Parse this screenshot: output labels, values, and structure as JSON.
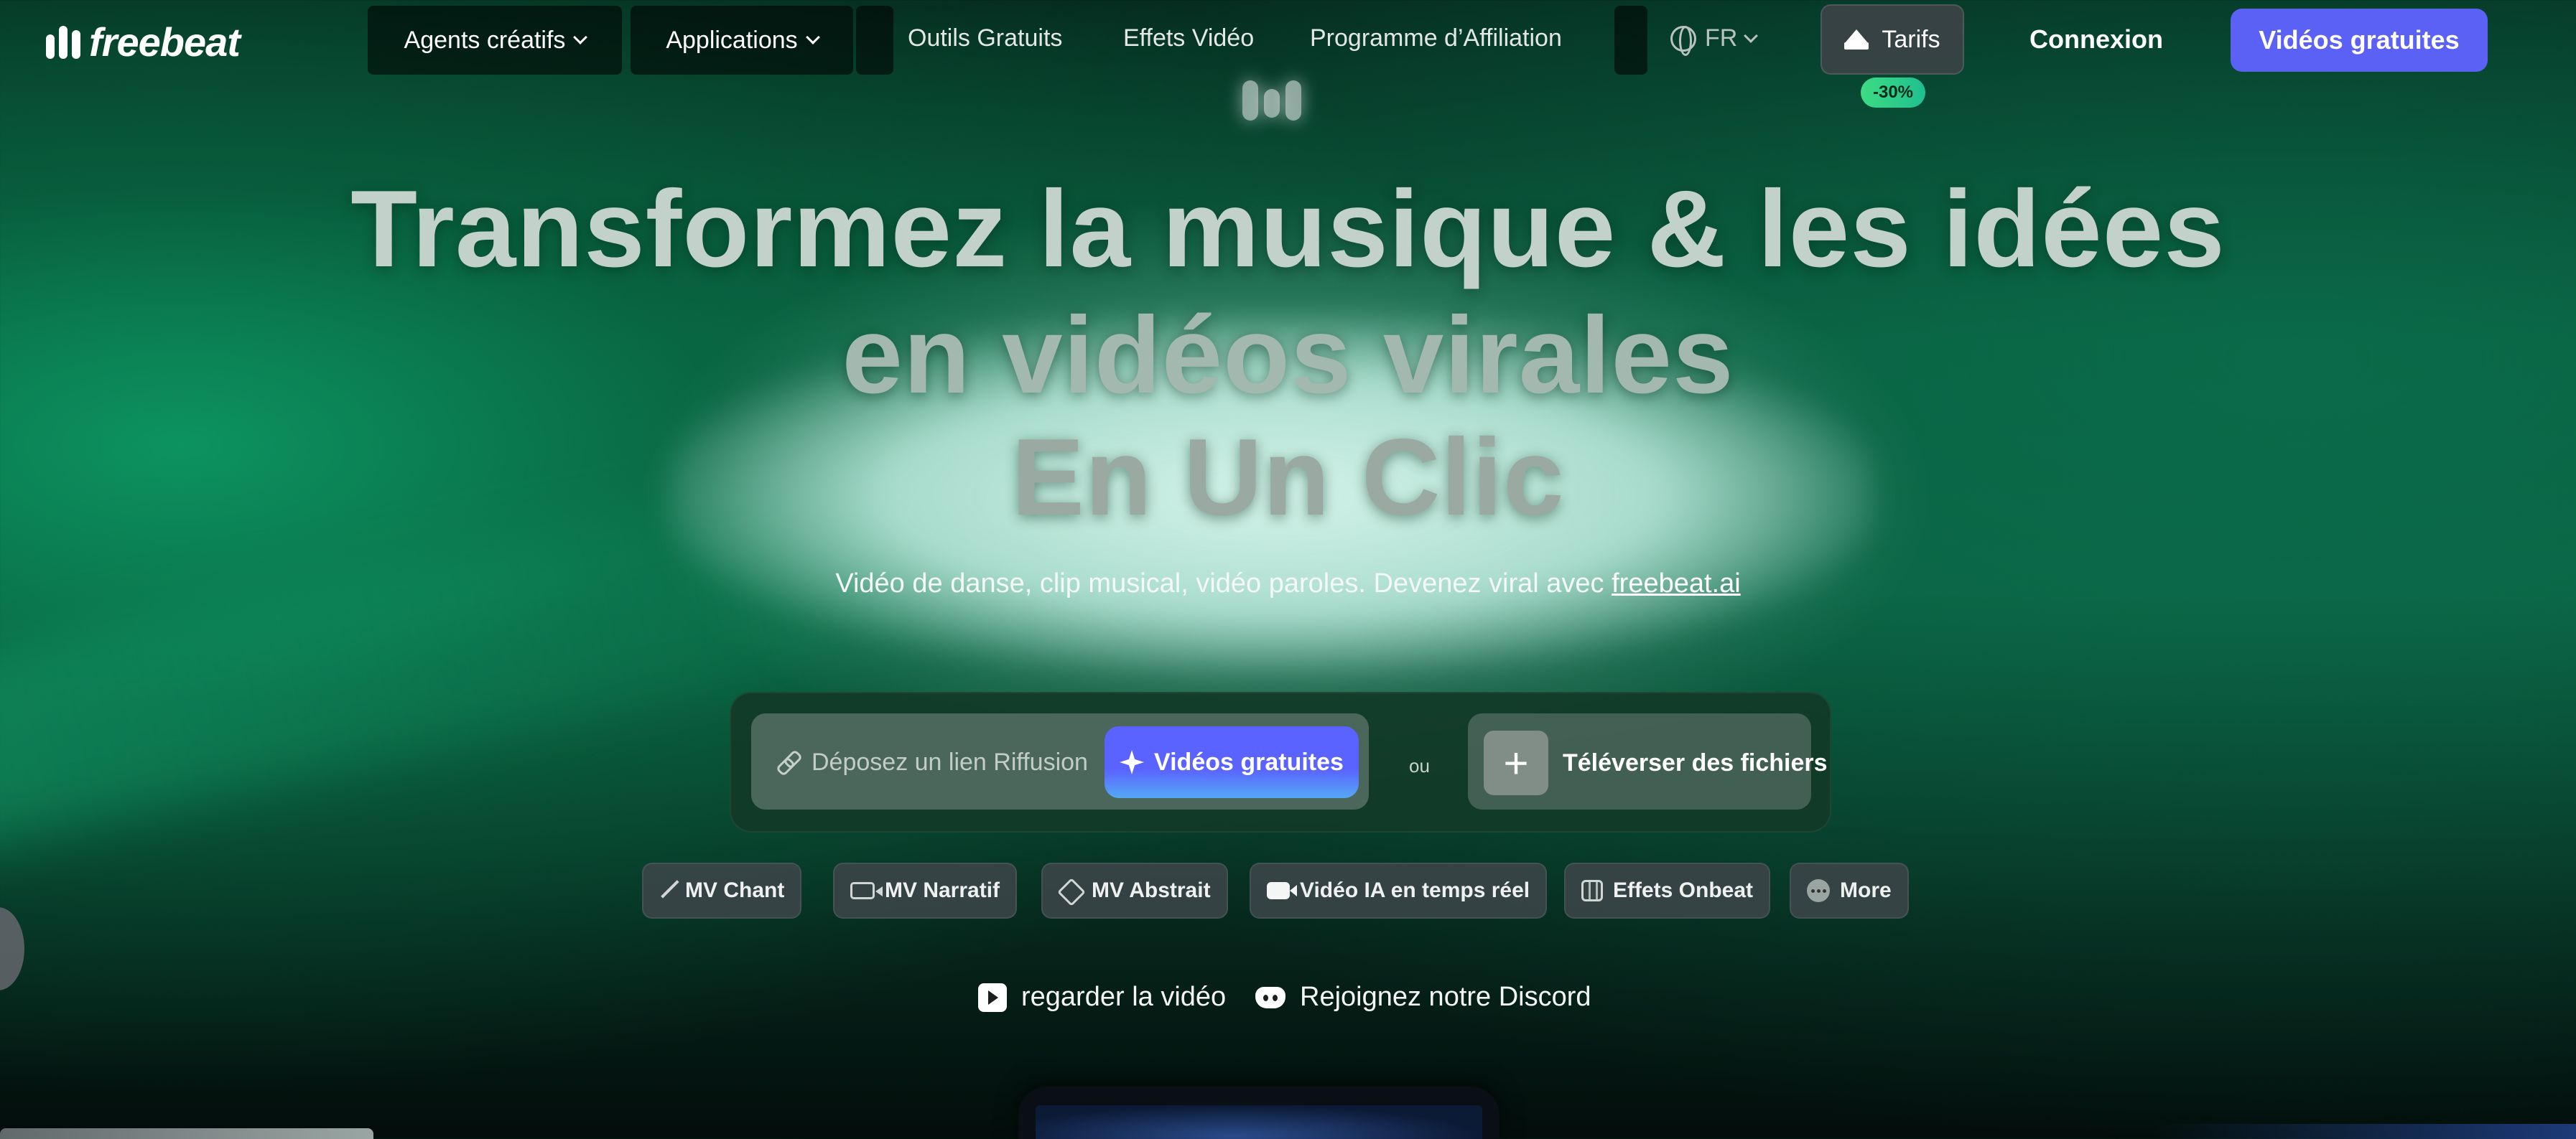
{
  "brand": {
    "name": "freebeat"
  },
  "nav": {
    "creative_agents": "Agents créatifs",
    "applications": "Applications",
    "free_tools": "Outils Gratuits",
    "video_effects": "Effets Vidéo",
    "affiliate_program": "Programme d’Affiliation",
    "language": "FR",
    "pricing": "Tarifs",
    "discount_badge": "-30%",
    "login": "Connexion",
    "free_videos_cta": "Vidéos gratuites"
  },
  "hero": {
    "line1": "Transformez la musique & les idées",
    "line2": "en vidéos virales",
    "line3": "En Un Clic",
    "subtitle_prefix": "Vidéo de danse, clip musical, vidéo paroles. Devenez viral avec ",
    "subtitle_link": "freebeat.ai"
  },
  "generator": {
    "link_placeholder": "Déposez un lien Riffusion",
    "generate_button": "Vidéos gratuites",
    "or_text": "ou",
    "upload_button": "Téléverser des fichiers"
  },
  "chips": [
    {
      "label": "MV Chant",
      "icon": "pen-icon"
    },
    {
      "label": "MV Narratif",
      "icon": "video-camera-icon"
    },
    {
      "label": "MV Abstrait",
      "icon": "nodes-icon"
    },
    {
      "label": "Vidéo IA en temps réel",
      "icon": "live-camera-icon"
    },
    {
      "label": "Effets Onbeat",
      "icon": "film-icon"
    },
    {
      "label": "More",
      "icon": "more-dots-icon"
    }
  ],
  "links": {
    "watch_video": "regarder la vidéo",
    "join_discord": "Rejoignez notre Discord"
  },
  "colors": {
    "primary_button": "#5b61f4",
    "discount_badge": "#3ddc84",
    "background_green": "#0a5a3c"
  }
}
